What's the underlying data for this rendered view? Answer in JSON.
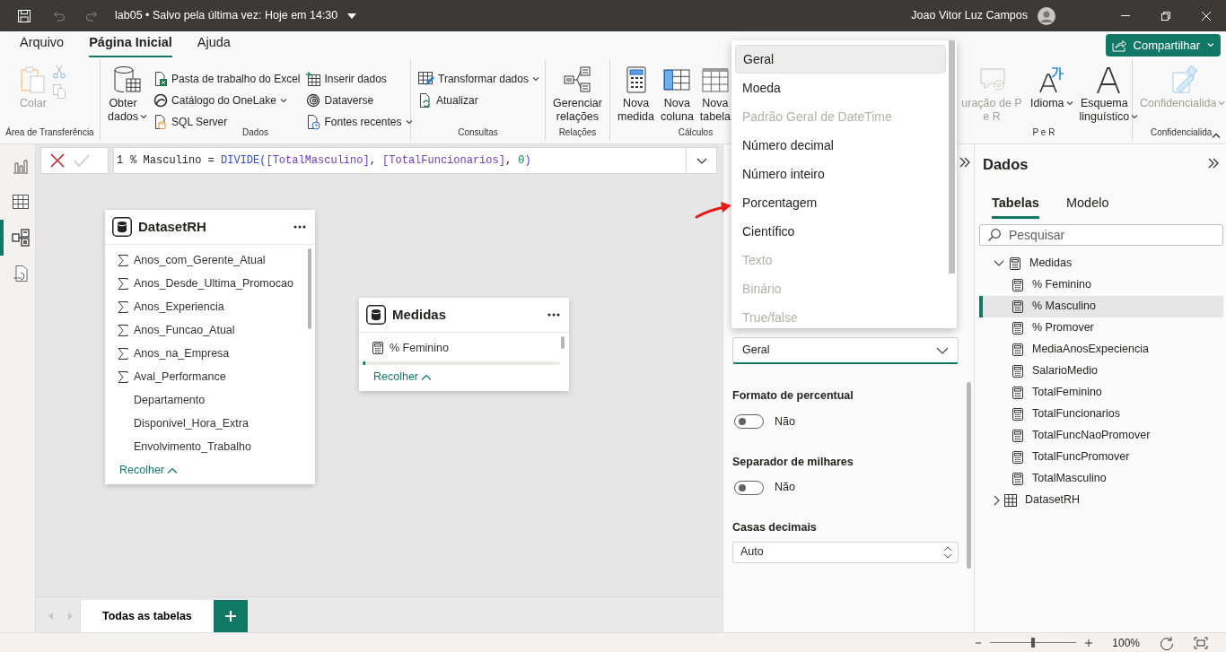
{
  "title_bar": {
    "title": "lab05 • Salvo pela última vez: Hoje em 14:30",
    "user_name": "Joao Vitor Luz Campos"
  },
  "ribbon_tabs": [
    {
      "label": "Arquivo",
      "selected": false
    },
    {
      "label": "Página Inicial",
      "selected": true
    },
    {
      "label": "Ajuda",
      "selected": false
    }
  ],
  "share_button": "Compartilhar",
  "ribbon_groups": [
    {
      "label": "Área de Transferência",
      "tools": [
        {
          "kind": "cut",
          "disabled": true
        },
        {
          "kind": "copy",
          "disabled": true
        }
      ],
      "buttons": [
        {
          "label": "Colar",
          "kind": "large",
          "disabled": true,
          "dropdown": false
        }
      ]
    },
    {
      "label": "Dados",
      "buttons": [
        {
          "label": "Obter dados",
          "kind": "large",
          "disabled": false,
          "dropdown": true
        },
        {
          "label": "Pasta de trabalho do Excel",
          "kind": "small",
          "disabled": false,
          "dropdown": false
        },
        {
          "label": "Catálogo do OneLake",
          "kind": "small",
          "disabled": false,
          "dropdown": true
        },
        {
          "label": "SQL Server",
          "kind": "small",
          "disabled": false,
          "dropdown": false
        },
        {
          "label": "Inserir dados",
          "kind": "small",
          "disabled": false,
          "dropdown": false
        },
        {
          "label": "Dataverse",
          "kind": "small",
          "disabled": false,
          "dropdown": false
        },
        {
          "label": "Fontes recentes",
          "kind": "small",
          "disabled": false,
          "dropdown": true
        }
      ]
    },
    {
      "label": "Consultas",
      "buttons": [
        {
          "label": "Transformar dados",
          "kind": "small",
          "disabled": false,
          "dropdown": true
        },
        {
          "label": "Atualizar",
          "kind": "small",
          "disabled": false,
          "dropdown": false
        }
      ]
    },
    {
      "label": "Relações",
      "buttons": [
        {
          "label": "Gerenciar relações",
          "kind": "large",
          "disabled": false,
          "dropdown": false
        }
      ]
    },
    {
      "label": "Cálculos",
      "buttons": [
        {
          "label": "Nova medida",
          "kind": "large",
          "disabled": false,
          "dropdown": false
        },
        {
          "label": "Nova coluna",
          "kind": "large",
          "disabled": false,
          "dropdown": false
        },
        {
          "label": "Nova tabela",
          "kind": "large",
          "disabled": false,
          "dropdown": false
        }
      ]
    },
    {
      "label": "P e R",
      "buttons": [
        {
          "label": "uração de P e R",
          "kind": "large",
          "disabled": true,
          "dropdown": false
        },
        {
          "label": "Idioma",
          "kind": "large",
          "disabled": false,
          "dropdown": true
        },
        {
          "label": "Esquema linguístico",
          "kind": "large",
          "disabled": false,
          "dropdown": true
        }
      ]
    },
    {
      "label": "Confidencialida",
      "buttons": [
        {
          "label": "Confidencialida",
          "kind": "large",
          "disabled": true,
          "dropdown": true
        }
      ]
    }
  ],
  "view_switcher": [
    {
      "kind": "report",
      "selected": false
    },
    {
      "kind": "table",
      "selected": false
    },
    {
      "kind": "model",
      "selected": true
    },
    {
      "kind": "dax",
      "selected": false
    }
  ],
  "formula_bar": {
    "line_number": "1",
    "tokens": [
      {
        "kind": "plain",
        "text": "% Masculino = "
      },
      {
        "kind": "function",
        "text": "DIVIDE"
      },
      {
        "kind": "paren",
        "text": "("
      },
      {
        "kind": "measure",
        "text": "[TotalMasculino]"
      },
      {
        "kind": "plain",
        "text": ", "
      },
      {
        "kind": "measure",
        "text": "[TotalFuncionarios]"
      },
      {
        "kind": "plain",
        "text": ", "
      },
      {
        "kind": "number",
        "text": "0"
      },
      {
        "kind": "paren",
        "text": ")"
      }
    ]
  },
  "diagram": {
    "tables": [
      {
        "name": "DatasetRH",
        "collapse_label": "Recolher",
        "fields": [
          {
            "name": "Anos_com_Gerente_Atual",
            "kind": "numeric"
          },
          {
            "name": "Anos_Desde_Ultima_Promocao",
            "kind": "numeric"
          },
          {
            "name": "Anos_Experiencia",
            "kind": "numeric"
          },
          {
            "name": "Anos_Funcao_Atual",
            "kind": "numeric"
          },
          {
            "name": "Anos_na_Empresa",
            "kind": "numeric"
          },
          {
            "name": "Aval_Performance",
            "kind": "numeric"
          },
          {
            "name": "Departamento",
            "kind": "text"
          },
          {
            "name": "Disponivel_Hora_Extra",
            "kind": "text"
          },
          {
            "name": "Envolvimento_Trabalho",
            "kind": "text"
          }
        ]
      },
      {
        "name": "Medidas",
        "collapse_label": "Recolher",
        "fields": [
          {
            "name": "% Feminino",
            "kind": "measure"
          }
        ]
      }
    ]
  },
  "page_tabs": [
    {
      "label": "Todas as tabelas",
      "selected": true
    }
  ],
  "properties": {
    "format_menu": [
      {
        "label": "Geral",
        "selected": true,
        "disabled": false
      },
      {
        "label": "Moeda",
        "selected": false,
        "disabled": false
      },
      {
        "label": "Padrão Geral de DateTime",
        "selected": false,
        "disabled": true
      },
      {
        "label": "Número decimal",
        "selected": false,
        "disabled": false
      },
      {
        "label": "Número inteiro",
        "selected": false,
        "disabled": false
      },
      {
        "label": "Porcentagem",
        "selected": false,
        "disabled": false
      },
      {
        "label": "Científico",
        "selected": false,
        "disabled": false
      },
      {
        "label": "Texto",
        "selected": false,
        "disabled": true
      },
      {
        "label": "Binário",
        "selected": false,
        "disabled": true
      },
      {
        "label": "True/false",
        "selected": false,
        "disabled": true
      }
    ],
    "format_value": "Geral",
    "toggles": [
      {
        "label": "Formato de percentual",
        "on": false,
        "state_text": "Não"
      },
      {
        "label": "Separador de milhares",
        "on": false,
        "state_text": "Não"
      }
    ],
    "decimal_places": {
      "label": "Casas decimais",
      "value": "Auto"
    }
  },
  "data_pane": {
    "title": "Dados",
    "tabs": [
      {
        "label": "Tabelas",
        "selected": true
      },
      {
        "label": "Modelo",
        "selected": false
      }
    ],
    "search": {
      "placeholder": "Pesquisar"
    },
    "tree": [
      {
        "label": "Medidas",
        "kind": "measures",
        "expanded": true,
        "selected": false,
        "children": [
          {
            "label": "% Feminino",
            "selected": false
          },
          {
            "label": "% Masculino",
            "selected": true
          },
          {
            "label": "% Promover",
            "selected": false
          },
          {
            "label": "MediaAnosExpeciencia",
            "selected": false
          },
          {
            "label": "SalarioMedio",
            "selected": false
          },
          {
            "label": "TotalFeminino",
            "selected": false
          },
          {
            "label": "TotalFuncionarios",
            "selected": false
          },
          {
            "label": "TotalFuncNaoPromover",
            "selected": false
          },
          {
            "label": "TotalFuncPromover",
            "selected": false
          },
          {
            "label": "TotalMasculino",
            "selected": false
          }
        ]
      },
      {
        "label": "DatasetRH",
        "kind": "table",
        "expanded": false,
        "selected": false
      }
    ]
  },
  "zoom": {
    "level": 0.5,
    "reading": "100%"
  }
}
